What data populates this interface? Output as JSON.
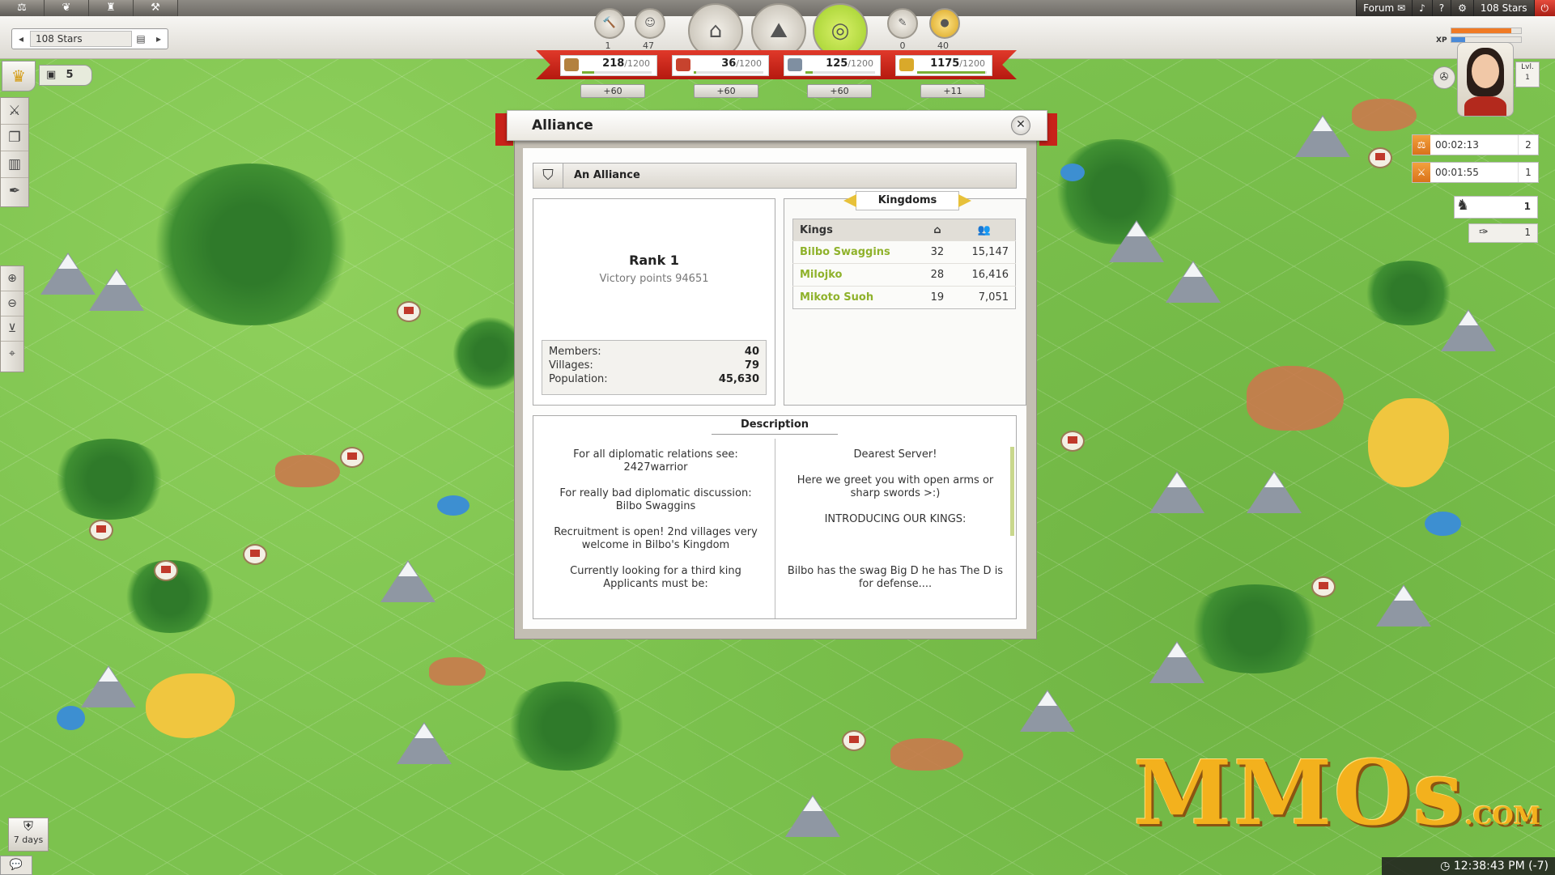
{
  "topbar": {
    "left_icons": [
      "scales-icon",
      "leaf-icon",
      "helmet-icon",
      "tools-icon"
    ],
    "forum_label": "Forum",
    "server_label": "108 Stars",
    "right_icons": [
      "chat-icon",
      "sound-icon",
      "help-icon",
      "gear-icon",
      "power-icon"
    ]
  },
  "server_selector": {
    "value": "108 Stars"
  },
  "top_counters": {
    "hammer": "1",
    "hero": "47",
    "reports": "0",
    "gold": "40"
  },
  "resources": [
    {
      "name": "wood",
      "current": "218",
      "max": "/1200",
      "production": "+60",
      "fill": 0.18,
      "color": "#b3813f"
    },
    {
      "name": "clay",
      "current": "36",
      "max": "/1200",
      "production": "+60",
      "fill": 0.03,
      "color": "#c7432e"
    },
    {
      "name": "iron",
      "current": "125",
      "max": "/1200",
      "production": "+60",
      "fill": 0.1,
      "color": "#7f8fa1"
    },
    {
      "name": "crop",
      "current": "1175",
      "max": "/1200",
      "production": "+11",
      "fill": 0.98,
      "color": "#d9a92a"
    }
  ],
  "crown_count": "5",
  "player": {
    "level_label": "Lvl.",
    "level": "1",
    "xp_label": "XP"
  },
  "timers": [
    {
      "time": "00:02:13",
      "count": "2"
    },
    {
      "time": "00:01:55",
      "count": "1"
    }
  ],
  "hero_slots": [
    "1",
    "1"
  ],
  "dialog": {
    "title": "Alliance",
    "alliance_name": "An Alliance",
    "rank_label": "Rank 1",
    "victory_points": "Victory points 94651",
    "stats": [
      {
        "label": "Members:",
        "value": "40"
      },
      {
        "label": "Villages:",
        "value": "79"
      },
      {
        "label": "Population:",
        "value": "45,630"
      }
    ],
    "kingdoms_title": "Kingdoms",
    "kings_header": "Kings",
    "kings": [
      {
        "name": "Bilbo Swaggins",
        "villages": "32",
        "population": "15,147"
      },
      {
        "name": "Milojko",
        "villages": "28",
        "population": "16,416"
      },
      {
        "name": "Mikoto Suoh",
        "villages": "19",
        "population": "7,051"
      }
    ],
    "description_title": "Description",
    "description_left": [
      "For all diplomatic relations see: 2427warrior",
      "For really bad diplomatic discussion: Bilbo Swaggins",
      "Recruitment is open! 2nd villages very welcome in Bilbo's Kingdom",
      "Currently looking for a third king Applicants must be:"
    ],
    "description_right": [
      "Dearest Server!",
      "Here we greet you with open arms or sharp swords >:)",
      "INTRODUCING OUR KINGS:",
      "",
      "Bilbo has the swag Big D he has The D is for defense...."
    ]
  },
  "bottom": {
    "days_label": "7 days",
    "clock": "12:38:43 PM (-7)",
    "watermark": "MMOs",
    "watermark_suffix": ".COM"
  }
}
